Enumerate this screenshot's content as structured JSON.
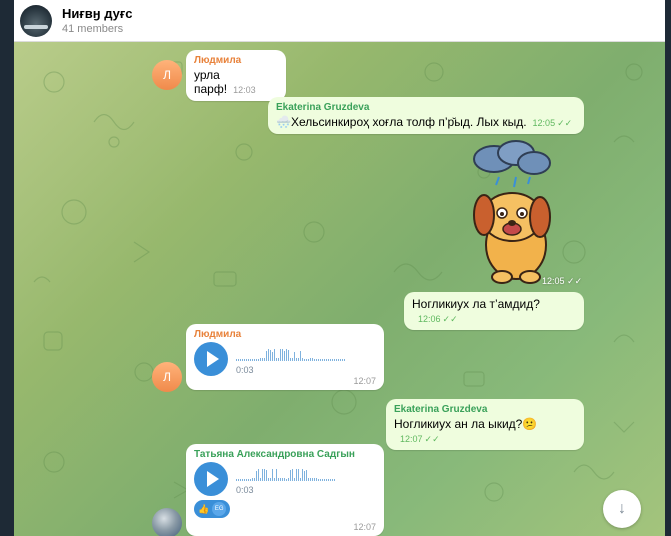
{
  "header": {
    "title": "Ниғвӈ дуғс",
    "subtitle": "41 members"
  },
  "messages": [
    {
      "author": "Людмила",
      "avatar_letter": "Л",
      "text": "урла парф!",
      "time": "12:03"
    },
    {
      "author": "Ekaterina Gruzdeva",
      "emoji": "🌨️",
      "text": "Хельсинкироҳ хоғла толф п’р̆ыд. Лых кыд.",
      "time": "12:05"
    },
    {
      "sticker": "sad-dog-rain-cloud",
      "time": "12:05"
    },
    {
      "text": "Ногликиух ла т’aмдид?",
      "time": "12:06"
    },
    {
      "author": "Людмила",
      "avatar_letter": "Л",
      "duration": "0:03",
      "time": "12:07"
    },
    {
      "author": "Ekaterina Gruzdeva",
      "text": "Ногликиух ан ла ыкид?",
      "emoji": "😕",
      "time": "12:07"
    },
    {
      "author": "Татьяна Александровна Садгын",
      "duration": "0:03",
      "time": "12:07",
      "reaction": "👍",
      "reaction_user": "EG"
    }
  ],
  "colors": {
    "accent": "#3a8fd8",
    "incoming_bubble": "#ffffff",
    "outgoing_bubble": "#effdde",
    "author_orange": "#e8823b",
    "author_green": "#3aa15a"
  },
  "icons": {
    "scroll_down": "arrow-down-icon",
    "read_check": "double-check-icon",
    "play": "play-icon"
  }
}
